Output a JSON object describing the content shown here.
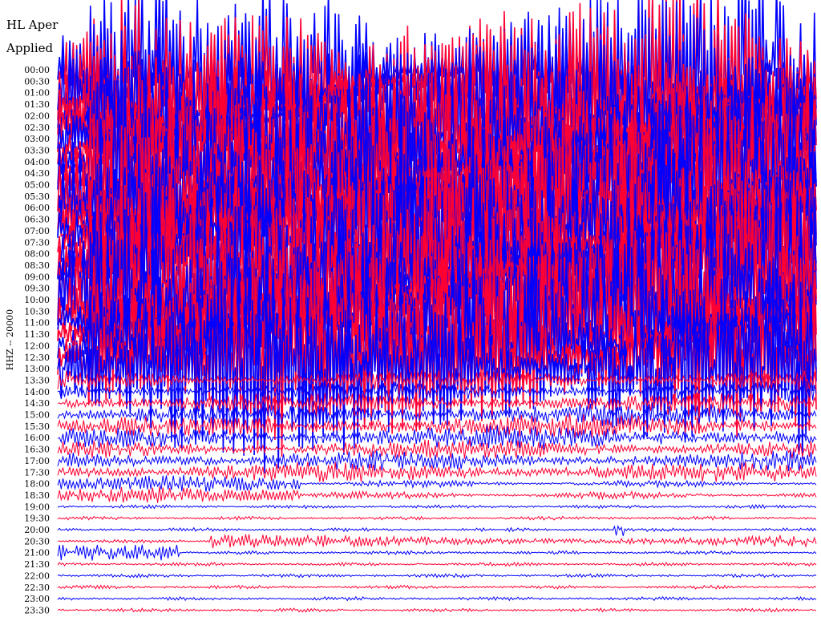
{
  "header": {
    "title_line_1": "HL Aper",
    "title_line_2": "Applied"
  },
  "chart_data": {
    "type": "helicorder",
    "channel_label": "HHZ -- 20000",
    "row_labels": [
      "00:00",
      "00:30",
      "01:00",
      "01:30",
      "02:00",
      "02:30",
      "03:00",
      "03:30",
      "04:00",
      "04:30",
      "05:00",
      "05:30",
      "06:00",
      "06:30",
      "07:00",
      "07:30",
      "08:00",
      "08:30",
      "09:00",
      "09:30",
      "10:00",
      "10:30",
      "11:00",
      "11:30",
      "12:00",
      "12:30",
      "13:00",
      "13:30",
      "14:00",
      "14:30",
      "15:00",
      "15:30",
      "16:00",
      "16:30",
      "17:00",
      "17:30",
      "18:00",
      "18:30",
      "19:00",
      "19:30",
      "20:00",
      "20:30",
      "21:00",
      "21:30",
      "22:00",
      "22:30",
      "23:00",
      "23:30"
    ],
    "trace_colors": [
      "#0000ff",
      "#ff0033"
    ],
    "row_interval_minutes": 30,
    "grid": false
  }
}
